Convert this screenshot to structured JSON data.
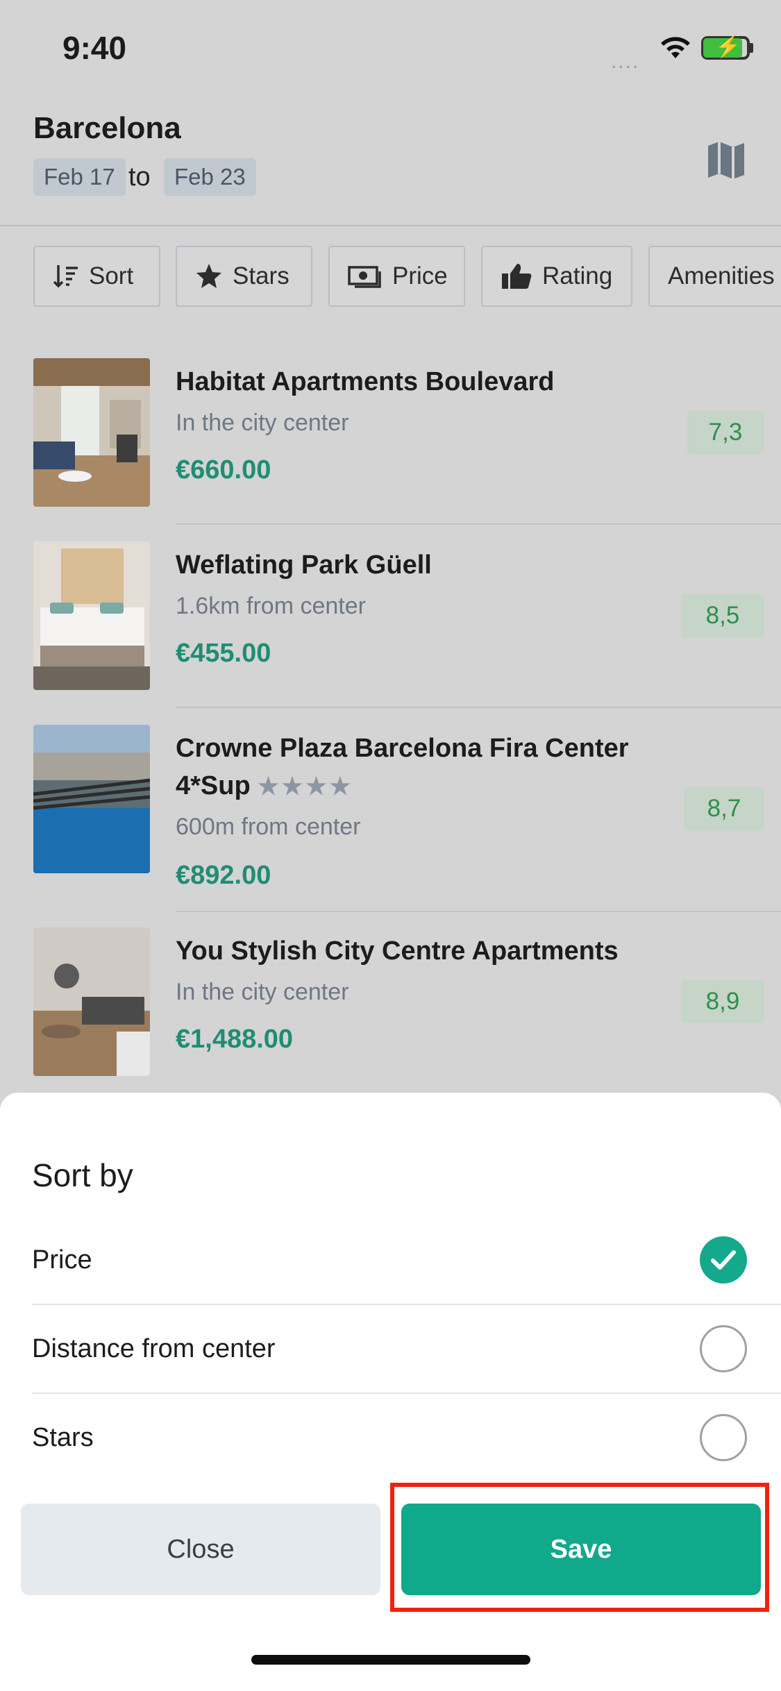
{
  "status_bar": {
    "time": "9:40",
    "signal": "....",
    "wifi_icon": "wifi-icon",
    "battery_icon": "battery-charging-icon"
  },
  "header": {
    "city": "Barcelona",
    "check_in": "Feb 17",
    "to_label": "to",
    "check_out": "Feb 23",
    "map_icon": "map-icon"
  },
  "filters": [
    {
      "label": "Sort",
      "icon": "sort-icon"
    },
    {
      "label": "Stars",
      "icon": "star-icon"
    },
    {
      "label": "Price",
      "icon": "money-icon"
    },
    {
      "label": "Rating",
      "icon": "thumbs-up-icon"
    },
    {
      "label": "Amenities",
      "icon": ""
    }
  ],
  "hotels": [
    {
      "name": "Habitat Apartments Boulevard",
      "location": "In the city center",
      "price": "€660.00",
      "score": "7,3"
    },
    {
      "name": "Weflating Park Güell",
      "location": "1.6km from center",
      "price": "€455.00",
      "score": "8,5"
    },
    {
      "name_line1": "Crowne Plaza Barcelona Fira Center",
      "name_line2": "4*Sup",
      "stars": "★★★★",
      "star_count": 4,
      "location": "600m from center",
      "price": "€892.00",
      "score": "8,7"
    },
    {
      "name": "You Stylish City Centre Apartments",
      "location": "In the city center",
      "price": "€1,488.00",
      "score": "8,9"
    }
  ],
  "sort_sheet": {
    "title": "Sort by",
    "options": [
      {
        "label": "Price",
        "selected": true
      },
      {
        "label": "Distance from center",
        "selected": false
      },
      {
        "label": "Stars",
        "selected": false
      }
    ],
    "close_label": "Close",
    "save_label": "Save"
  },
  "colors": {
    "accent": "#11a98c",
    "price_text": "#1f8d75",
    "score_bg": "#c5d5c8",
    "score_text": "#2f8f4a",
    "highlight": "#f0220f"
  }
}
